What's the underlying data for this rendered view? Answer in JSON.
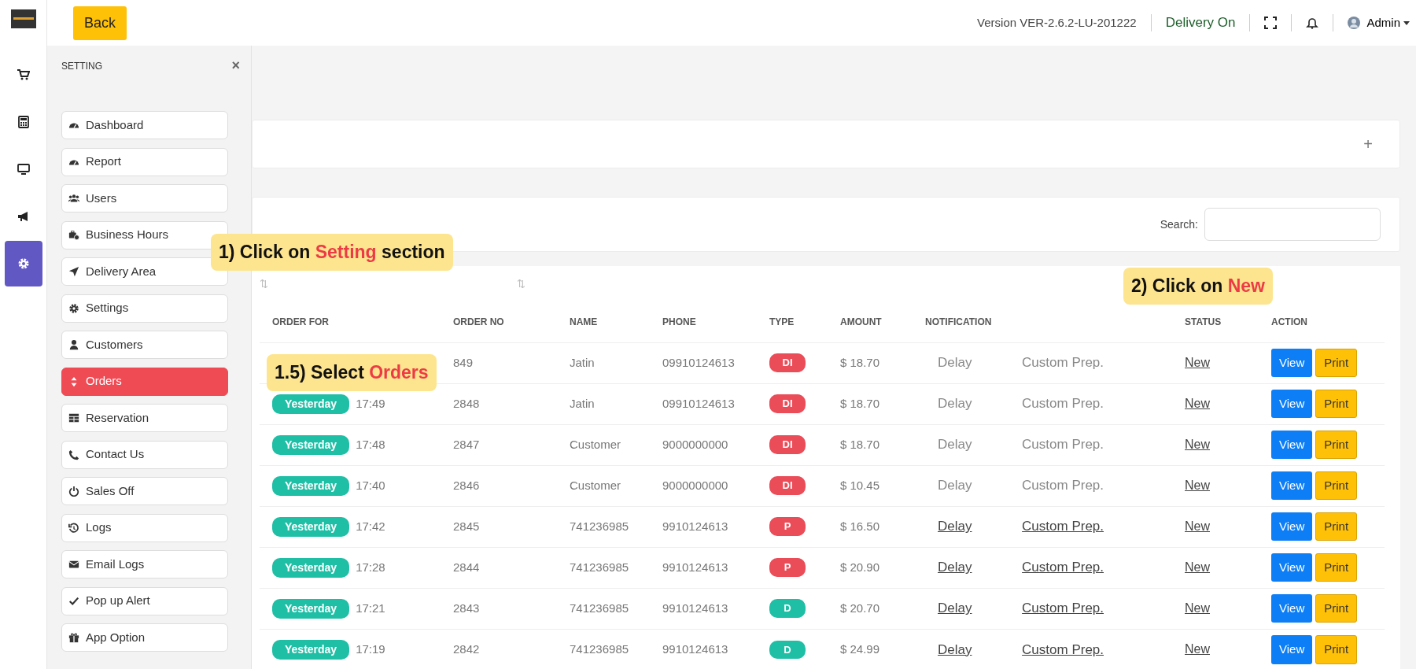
{
  "top_bar": {
    "back_button": "Back",
    "version": "Version VER-2.6.2-LU-201222",
    "delivery_status": "Delivery On",
    "user": "Admin"
  },
  "rail": {
    "items": [
      {
        "selected": false
      },
      {
        "selected": false
      },
      {
        "selected": false
      },
      {
        "selected": false
      },
      {
        "selected": true
      }
    ]
  },
  "setting_panel": {
    "title": "SETTING",
    "close": "×",
    "items": [
      {
        "label": "Dashboard",
        "selected": false
      },
      {
        "label": "Report",
        "selected": false
      },
      {
        "label": "Users",
        "selected": false
      },
      {
        "label": "Business Hours",
        "selected": false
      },
      {
        "label": "Delivery Area",
        "selected": false
      },
      {
        "label": "Settings",
        "selected": false
      },
      {
        "label": "Customers",
        "selected": false
      },
      {
        "label": "Orders",
        "selected": true
      },
      {
        "label": "Reservation",
        "selected": false
      },
      {
        "label": "Contact Us",
        "selected": false
      },
      {
        "label": "Sales Off",
        "selected": false
      },
      {
        "label": "Logs",
        "selected": false
      },
      {
        "label": "Email Logs",
        "selected": false
      },
      {
        "label": "Pop up Alert",
        "selected": false
      },
      {
        "label": "App Option",
        "selected": false
      }
    ]
  },
  "filter_card": {
    "expand": "+"
  },
  "search": {
    "label": "Search:"
  },
  "table": {
    "sort_marks": [
      "⇅",
      "⇅"
    ],
    "columns": [
      "ORDER FOR",
      "ORDER NO",
      "NAME",
      "PHONE",
      "TYPE",
      "AMOUNT",
      "NOTIFICATION",
      "STATUS",
      "ACTION"
    ],
    "rows": [
      {
        "order_no": "849",
        "name": "Jatin",
        "phone": "09910124613",
        "type": {
          "label": "DI",
          "color": "#ea4c58"
        },
        "amount": "$ 18.70",
        "delay": "Delay",
        "prep": "Custom Prep.",
        "linked": false,
        "status": "New",
        "actions": [
          "View",
          "Print"
        ]
      },
      {
        "day": "Yesterday",
        "time": "17:49",
        "order_no": "2848",
        "name": "Jatin",
        "phone": "09910124613",
        "type": {
          "label": "DI",
          "color": "#ea4c58"
        },
        "amount": "$ 18.70",
        "delay": "Delay",
        "prep": "Custom Prep.",
        "linked": false,
        "status": "New",
        "actions": [
          "View",
          "Print"
        ]
      },
      {
        "day": "Yesterday",
        "time": "17:48",
        "order_no": "2847",
        "name": "Customer",
        "phone": "9000000000",
        "type": {
          "label": "DI",
          "color": "#ea4c58"
        },
        "amount": "$ 18.70",
        "delay": "Delay",
        "prep": "Custom Prep.",
        "linked": false,
        "status": "New",
        "actions": [
          "View",
          "Print"
        ]
      },
      {
        "day": "Yesterday",
        "time": "17:40",
        "order_no": "2846",
        "name": "Customer",
        "phone": "9000000000",
        "type": {
          "label": "DI",
          "color": "#ea4c58"
        },
        "amount": "$ 10.45",
        "delay": "Delay",
        "prep": "Custom Prep.",
        "linked": false,
        "status": "New",
        "actions": [
          "View",
          "Print"
        ]
      },
      {
        "day": "Yesterday",
        "time": "17:42",
        "order_no": "2845",
        "name": "741236985",
        "phone": "9910124613",
        "type": {
          "label": "P",
          "color": "#ea4c58"
        },
        "amount": "$ 16.50",
        "delay": "Delay",
        "prep": "Custom Prep.",
        "linked": true,
        "status": "New",
        "actions": [
          "View",
          "Print"
        ]
      },
      {
        "day": "Yesterday",
        "time": "17:28",
        "order_no": "2844",
        "name": "741236985",
        "phone": "9910124613",
        "type": {
          "label": "P",
          "color": "#ea4c58"
        },
        "amount": "$ 20.90",
        "delay": "Delay",
        "prep": "Custom Prep.",
        "linked": true,
        "status": "New",
        "actions": [
          "View",
          "Print"
        ]
      },
      {
        "day": "Yesterday",
        "time": "17:21",
        "order_no": "2843",
        "name": "741236985",
        "phone": "9910124613",
        "type": {
          "label": "D",
          "color": "#1fbfa6"
        },
        "amount": "$ 20.70",
        "delay": "Delay",
        "prep": "Custom Prep.",
        "linked": true,
        "status": "New",
        "actions": [
          "View",
          "Print"
        ]
      },
      {
        "day": "Yesterday",
        "time": "17:19",
        "order_no": "2842",
        "name": "741236985",
        "phone": "9910124613",
        "type": {
          "label": "D",
          "color": "#1fbfa6"
        },
        "amount": "$ 24.99",
        "delay": "Delay",
        "prep": "Custom Prep.",
        "linked": true,
        "status": "New",
        "actions": [
          "View",
          "Print"
        ]
      }
    ]
  },
  "callouts": [
    {
      "before": "1) Click on ",
      "highlight": "Setting",
      "after": " section"
    },
    {
      "before": "2) Click on ",
      "highlight": "New"
    },
    {
      "before": "1.5) Select ",
      "highlight": "Orders"
    }
  ]
}
